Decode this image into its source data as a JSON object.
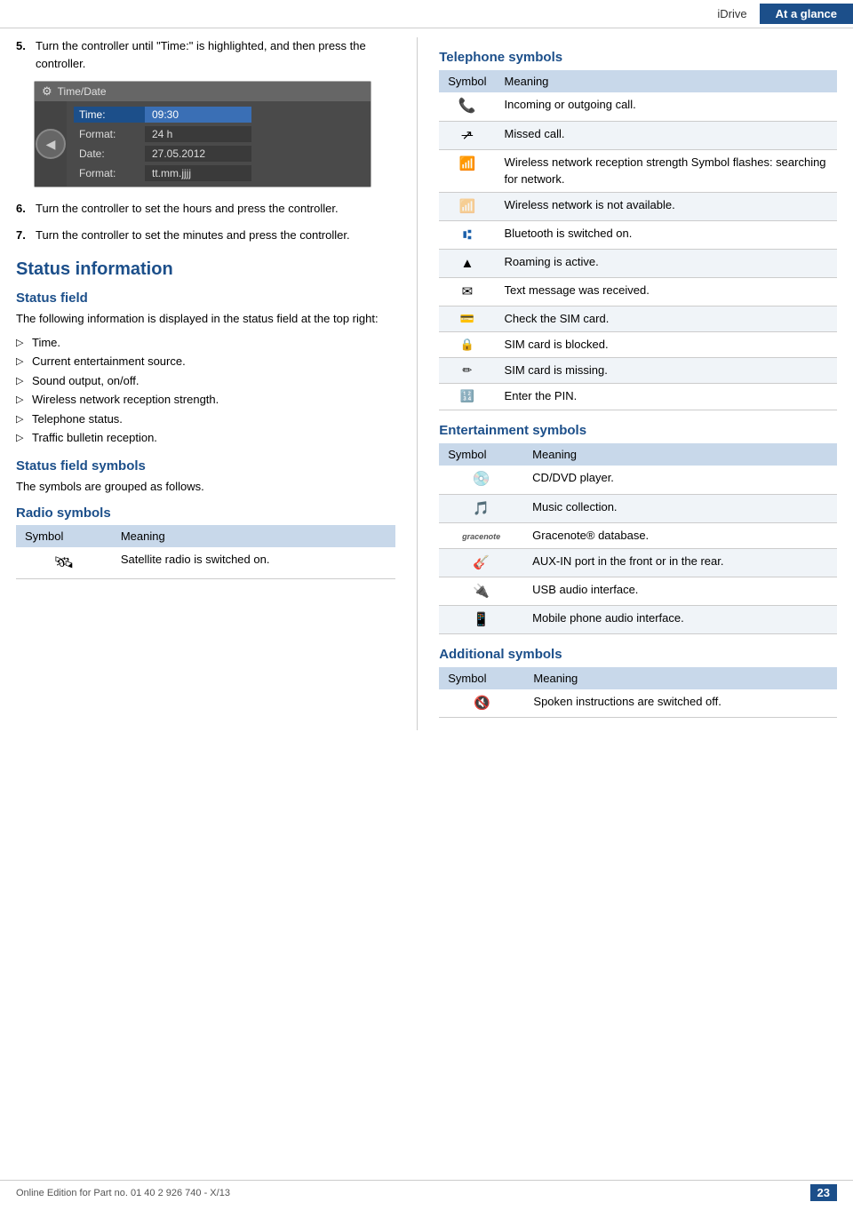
{
  "header": {
    "idrive_label": "iDrive",
    "ataglance_label": "At a glance"
  },
  "left": {
    "step5": {
      "num": "5.",
      "text": "Turn the controller until \"Time:\" is highlighted, and then press the controller."
    },
    "time_date_box": {
      "title": "Time/Date",
      "rows": [
        {
          "label": "Time:",
          "value": "09:30",
          "highlighted": true
        },
        {
          "label": "Format:",
          "value": "24 h",
          "highlighted": false
        },
        {
          "label": "Date:",
          "value": "27.05.2012",
          "highlighted": false
        },
        {
          "label": "Format:",
          "value": "tt.mm.jjjj",
          "highlighted": false
        }
      ]
    },
    "step6": {
      "num": "6.",
      "text": "Turn the controller to set the hours and press the controller."
    },
    "step7": {
      "num": "7.",
      "text": "Turn the controller to set the minutes and press the controller."
    },
    "status_information": {
      "title": "Status information",
      "status_field_title": "Status field",
      "status_field_desc": "The following information is displayed in the status field at the top right:",
      "bullets": [
        "Time.",
        "Current entertainment source.",
        "Sound output, on/off.",
        "Wireless network reception strength.",
        "Telephone status.",
        "Traffic bulletin reception."
      ],
      "status_field_symbols_title": "Status field symbols",
      "status_field_symbols_desc": "The symbols are grouped as follows.",
      "radio_symbols_title": "Radio symbols",
      "radio_table": {
        "headers": [
          "Symbol",
          "Meaning"
        ],
        "rows": [
          {
            "symbol": "🔊",
            "meaning": "Satellite radio is switched on."
          }
        ]
      }
    }
  },
  "right": {
    "telephone_symbols": {
      "title": "Telephone symbols",
      "headers": [
        "Symbol",
        "Meaning"
      ],
      "rows": [
        {
          "symbol": "📞",
          "meaning": "Incoming or outgoing call."
        },
        {
          "symbol": "↗̶",
          "meaning": "Missed call."
        },
        {
          "symbol": "📶",
          "meaning": "Wireless network reception strength Symbol flashes: searching for network."
        },
        {
          "symbol": "📵",
          "meaning": "Wireless network is not available."
        },
        {
          "symbol": "🔵",
          "meaning": "Bluetooth is switched on."
        },
        {
          "symbol": "▲",
          "meaning": "Roaming is active."
        },
        {
          "symbol": "✉",
          "meaning": "Text message was received."
        },
        {
          "symbol": "💳",
          "meaning": "Check the SIM card."
        },
        {
          "symbol": "🔒",
          "meaning": "SIM card is blocked."
        },
        {
          "symbol": "✏",
          "meaning": "SIM card is missing."
        },
        {
          "symbol": "🔢",
          "meaning": "Enter the PIN."
        }
      ]
    },
    "entertainment_symbols": {
      "title": "Entertainment symbols",
      "headers": [
        "Symbol",
        "Meaning"
      ],
      "rows": [
        {
          "symbol": "💿",
          "meaning": "CD/DVD player."
        },
        {
          "symbol": "🎵",
          "meaning": "Music collection."
        },
        {
          "symbol": "G",
          "meaning": "Gracenote® database."
        },
        {
          "symbol": "🎸",
          "meaning": "AUX-IN port in the front or in the rear."
        },
        {
          "symbol": "🔌",
          "meaning": "USB audio interface."
        },
        {
          "symbol": "📱",
          "meaning": "Mobile phone audio interface."
        }
      ]
    },
    "additional_symbols": {
      "title": "Additional symbols",
      "headers": [
        "Symbol",
        "Meaning"
      ],
      "rows": [
        {
          "symbol": "🔇",
          "meaning": "Spoken instructions are switched off."
        }
      ]
    }
  },
  "footer": {
    "left_text": "Online Edition for Part no. 01 40 2 926 740 - X/13",
    "page_num": "23"
  }
}
